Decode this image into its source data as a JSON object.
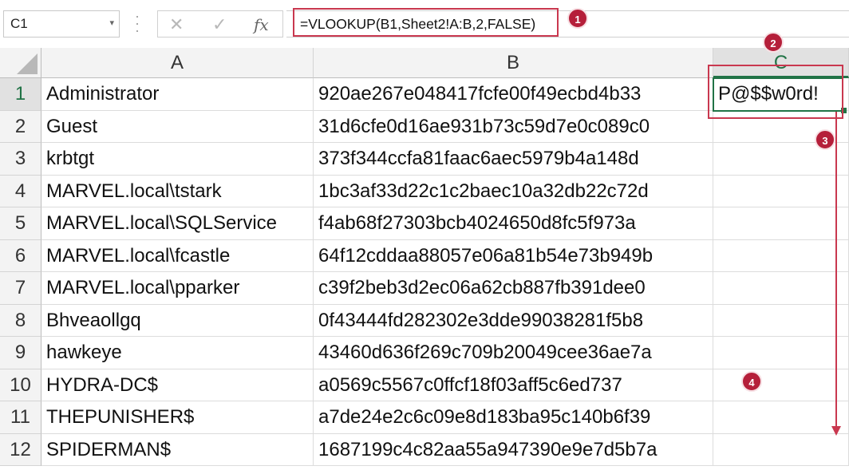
{
  "name_box": "C1",
  "formula_icons": {
    "cancel": "✕",
    "enter": "✓",
    "fx": "fx"
  },
  "formula": "=VLOOKUP(B1,Sheet2!A:B,2,FALSE)",
  "columns": [
    "A",
    "B",
    "C"
  ],
  "rows": [
    {
      "num": "1",
      "a": "Administrator",
      "b": "920ae267e048417fcfe00f49ecbd4b33",
      "c": "P@$$w0rd!"
    },
    {
      "num": "2",
      "a": "Guest",
      "b": "31d6cfe0d16ae931b73c59d7e0c089c0",
      "c": ""
    },
    {
      "num": "3",
      "a": "krbtgt",
      "b": "373f344ccfa81faac6aec5979b4a148d",
      "c": ""
    },
    {
      "num": "4",
      "a": "MARVEL.local\\tstark",
      "b": "1bc3af33d22c1c2baec10a32db22c72d",
      "c": ""
    },
    {
      "num": "5",
      "a": "MARVEL.local\\SQLService",
      "b": "f4ab68f27303bcb4024650d8fc5f973a",
      "c": ""
    },
    {
      "num": "6",
      "a": "MARVEL.local\\fcastle",
      "b": "64f12cddaa88057e06a81b54e73b949b",
      "c": ""
    },
    {
      "num": "7",
      "a": "MARVEL.local\\pparker",
      "b": "c39f2beb3d2ec06a62cb887fb391dee0",
      "c": ""
    },
    {
      "num": "8",
      "a": "Bhveaollgq",
      "b": "0f43444fd282302e3dde99038281f5b8",
      "c": ""
    },
    {
      "num": "9",
      "a": "hawkeye",
      "b": "43460d636f269c709b20049cee36ae7a",
      "c": ""
    },
    {
      "num": "10",
      "a": "HYDRA-DC$",
      "b": "a0569c5567c0ffcf18f03aff5c6ed737",
      "c": ""
    },
    {
      "num": "11",
      "a": "THEPUNISHER$",
      "b": "a7de24e2c6c09e8d183ba95c140b6f39",
      "c": ""
    },
    {
      "num": "12",
      "a": "SPIDERMAN$",
      "b": "1687199c4c82aa55a947390e9e7d5b7a",
      "c": ""
    }
  ],
  "callouts": [
    "1",
    "2",
    "3",
    "4"
  ],
  "accent_color": "#217346",
  "annotation_color": "#c9384f"
}
